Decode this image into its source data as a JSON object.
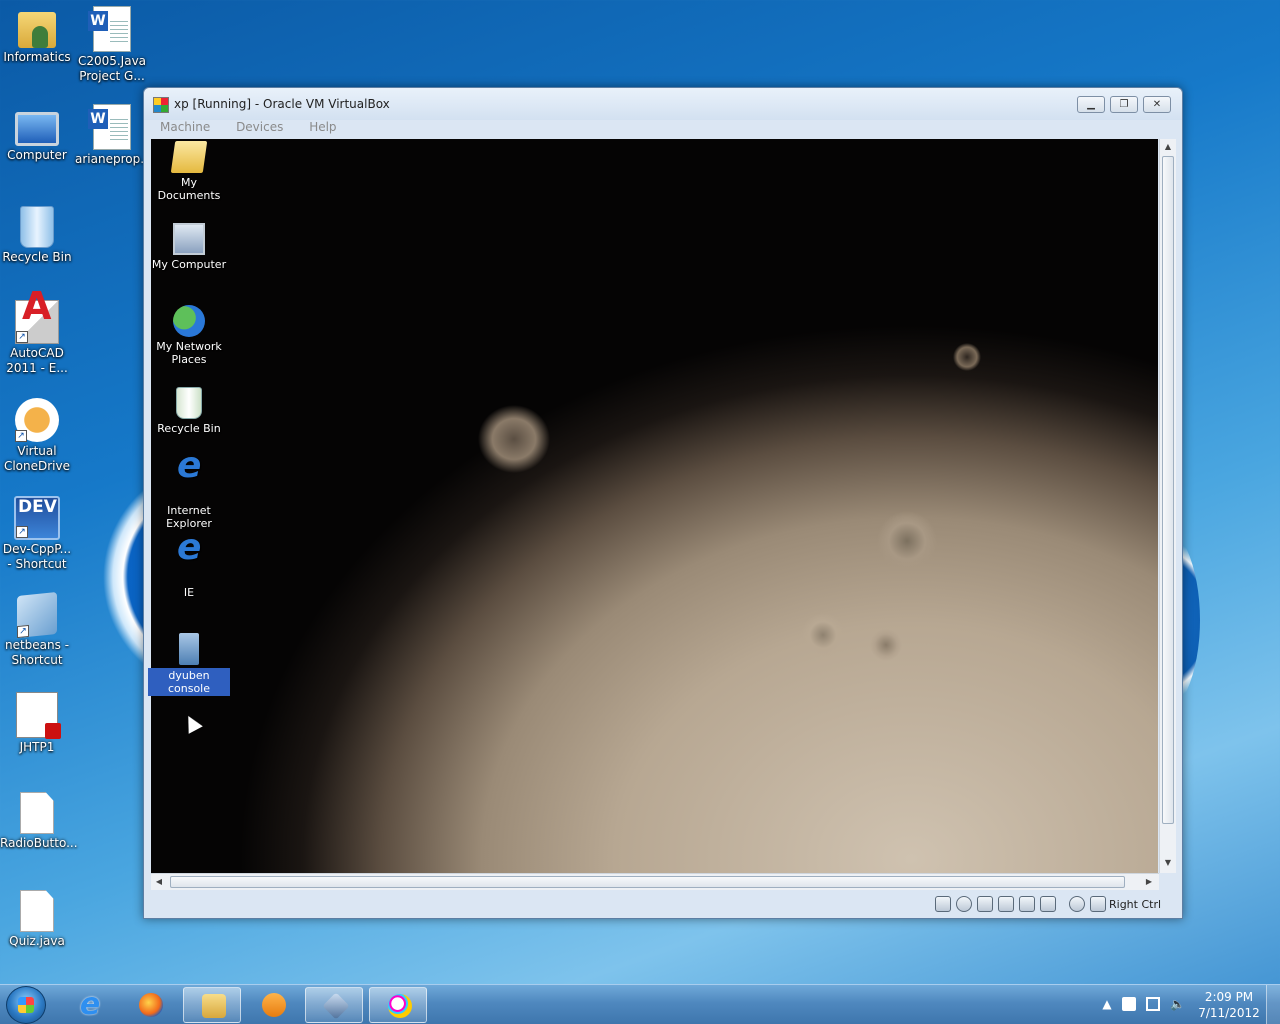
{
  "desktop": {
    "icons": [
      {
        "label": "Informatics",
        "name": "informatics-folder-icon"
      },
      {
        "label": "C2005.Java Project G...",
        "name": "word-document-icon"
      },
      {
        "label": "Computer",
        "name": "computer-icon"
      },
      {
        "label": "arianeprop...",
        "name": "word-document-icon"
      },
      {
        "label": "Recycle Bin",
        "name": "recycle-bin-icon"
      },
      {
        "label": "AutoCAD 2011 - E...",
        "name": "autocad-icon"
      },
      {
        "label": "Virtual CloneDrive",
        "name": "clonedrive-icon"
      },
      {
        "label": "Dev-CppP... - Shortcut",
        "name": "devcpp-icon"
      },
      {
        "label": "netbeans - Shortcut",
        "name": "netbeans-icon"
      },
      {
        "label": "JHTP1",
        "name": "pdf-icon"
      },
      {
        "label": "RadioButto...",
        "name": "file-icon"
      },
      {
        "label": "Quiz.java",
        "name": "file-icon"
      }
    ]
  },
  "vbox": {
    "title": "xp [Running] - Oracle VM VirtualBox",
    "menu": [
      "Machine",
      "Devices",
      "Help"
    ],
    "host_key": "Right Ctrl",
    "guest_icons": [
      {
        "label": "My Documents"
      },
      {
        "label": "My Computer"
      },
      {
        "label": "My Network Places"
      },
      {
        "label": "Recycle Bin"
      },
      {
        "label": "Internet Explorer"
      },
      {
        "label": "IE"
      },
      {
        "label": "dyuben console"
      }
    ]
  },
  "taskbar": {
    "clock_time": "2:09 PM",
    "clock_date": "7/11/2012"
  }
}
